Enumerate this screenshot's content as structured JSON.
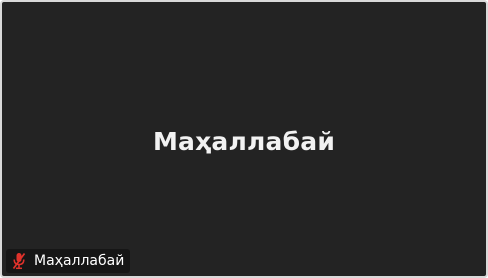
{
  "participant": {
    "display_name": "Маҳаллабай",
    "tag_label": "Маҳаллабай",
    "mic_state": "muted",
    "mic_icon": "mic-muted-icon"
  },
  "colors": {
    "tile_background": "#232323",
    "tile_border": "#d9d9d9",
    "name_text": "#f2f2f2",
    "tag_background": "#161616",
    "muted_accent": "#e0322b"
  }
}
